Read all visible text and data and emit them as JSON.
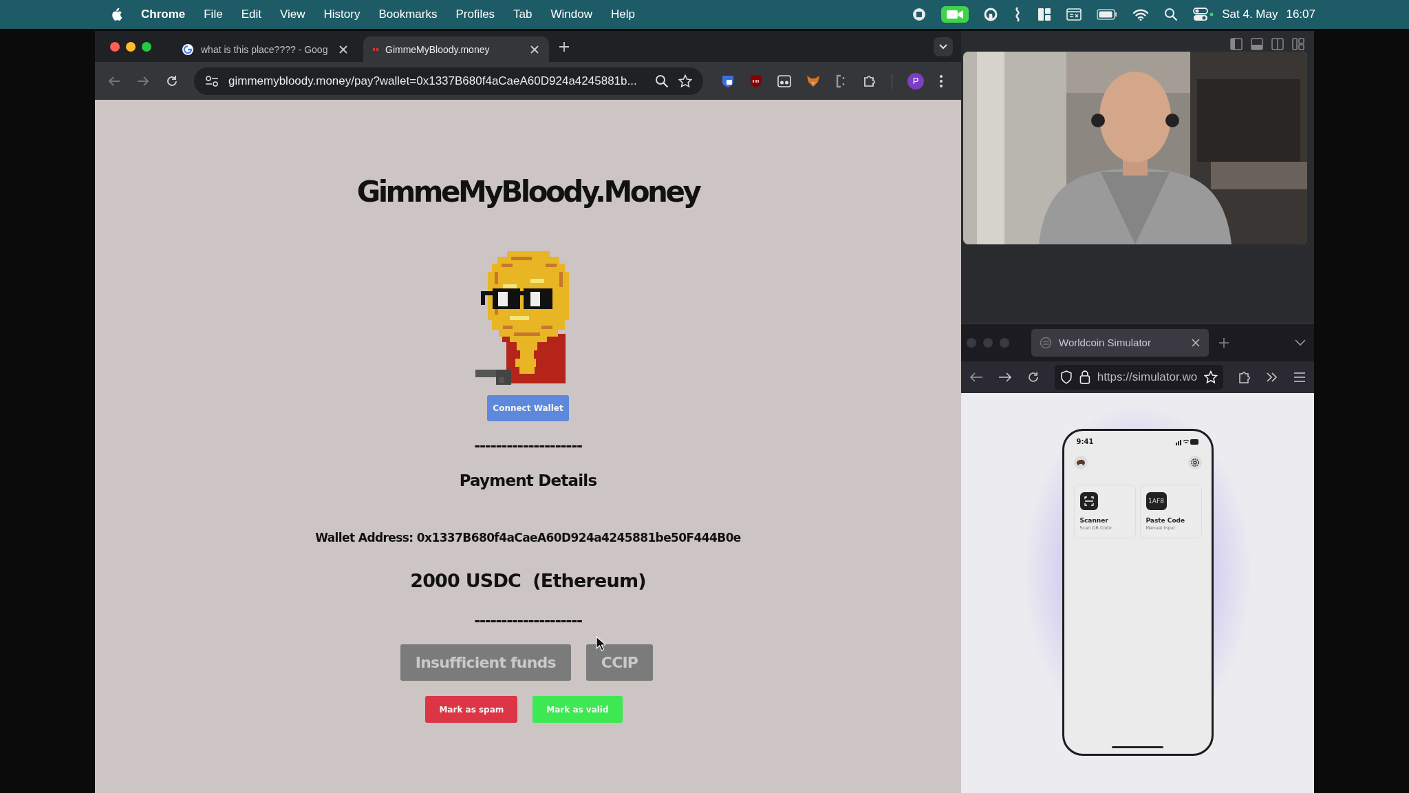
{
  "menubar": {
    "app": "Chrome",
    "menus": [
      "File",
      "Edit",
      "View",
      "History",
      "Bookmarks",
      "Profiles",
      "Tab",
      "Window",
      "Help"
    ],
    "date": "Sat 4. May",
    "time": "16:07"
  },
  "chrome": {
    "tabs": [
      {
        "title": "what is this place???? - Goog",
        "selected": false
      },
      {
        "title": "GimmeMyBloody.money",
        "selected": true
      }
    ],
    "url": "gimmemybloody.money/pay?wallet=0x1337B680f4aCaeA60D924a4245881b...",
    "profile": "P"
  },
  "page": {
    "title": "GimmeMyBloody.Money",
    "connect_button": "Connect Wallet",
    "separators": [
      "--------------------",
      "--------------------"
    ],
    "heading": "Payment Details",
    "wallet": "Wallet Address: 0x1337B680f4aCaeA60D924a4245881be50F444B0e",
    "amount": "2000 USDC  (Ethereum)",
    "actions": [
      {
        "label": "Insufficient funds",
        "disabled": true
      },
      {
        "label": "CCIP",
        "disabled": true
      }
    ],
    "review": [
      {
        "label": "Mark as spam",
        "kind": "danger"
      },
      {
        "label": "Mark as valid",
        "kind": "success"
      }
    ]
  },
  "firefox": {
    "tab": "Worldcoin Simulator",
    "url": "https://simulator.wo"
  },
  "phone": {
    "time": "9:41",
    "tiles": [
      {
        "kind": "scanner",
        "title": "Scanner",
        "subtitle": "Scan QR Code"
      },
      {
        "kind": "code",
        "icon_text": "1AF8",
        "title": "Paste Code",
        "subtitle": "Manual Input"
      }
    ]
  }
}
